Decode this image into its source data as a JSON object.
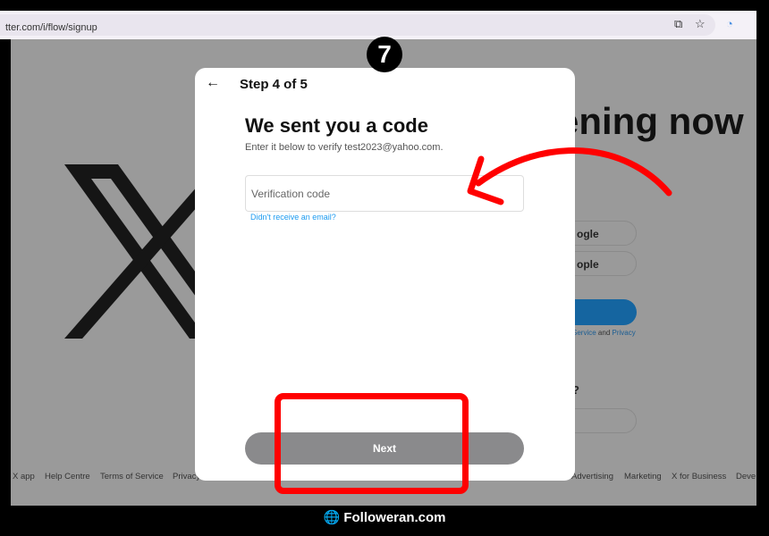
{
  "browser": {
    "url": "tter.com/i/flow/signup"
  },
  "background": {
    "headline": "ening now",
    "google_btn": "ogle",
    "apple_btn": "ople",
    "legal_service": "Service",
    "legal_and": "and",
    "legal_privacy": "Privacy",
    "question": "?",
    "footer": [
      "X app",
      "Help Centre",
      "Terms of Service",
      "Privacy Policy",
      "Advertising",
      "Marketing",
      "X for Business",
      "Deve"
    ]
  },
  "badge": "7",
  "modal": {
    "step": "Step 4 of 5",
    "title": "We sent you a code",
    "subtitle": "Enter it below to verify test2023@yahoo.com.",
    "input_placeholder": "Verification code",
    "resend_link": "Didn't receive an email?",
    "next_label": "Next"
  },
  "watermark": "Followeran.com",
  "colors": {
    "annotation": "#ff0000",
    "link": "#1d9bf0",
    "next_disabled": "#8a8a8c"
  }
}
